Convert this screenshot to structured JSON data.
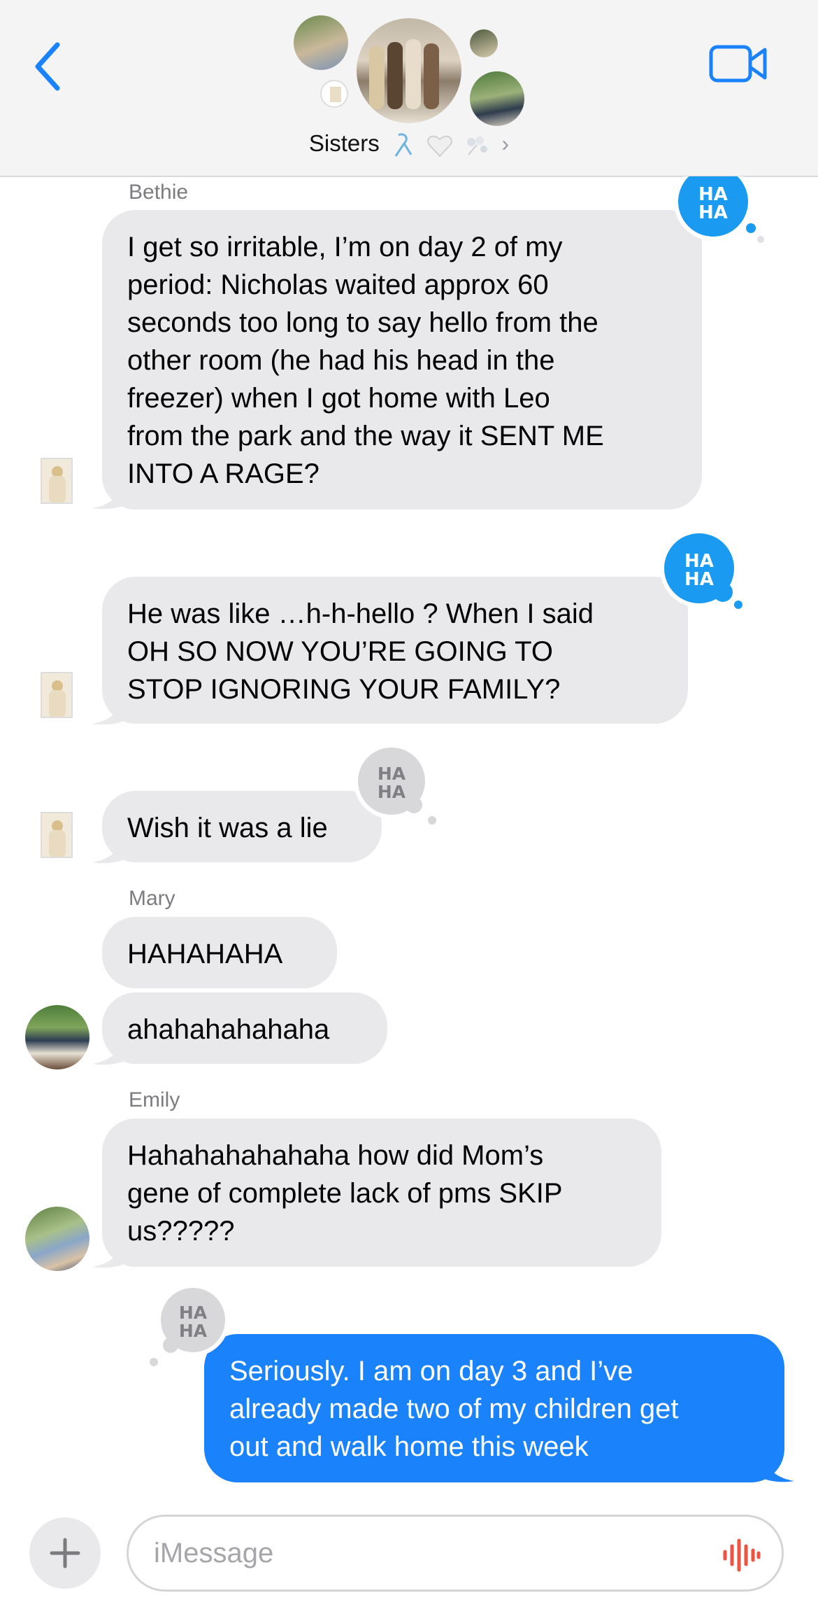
{
  "header": {
    "back_icon": "chevron-left-icon",
    "video_icon": "video-camera-icon",
    "group_name": "Sisters",
    "title_emoji": [
      "ribbon-icon",
      "white-heart-icon",
      "blossom-icon"
    ],
    "chevron": "›"
  },
  "messages": [
    {
      "sender": "Bethie",
      "text_lines": [
        "I get so irritable, I’m on day 2 of my",
        "period: Nicholas waited approx 60",
        "seconds too long to say hello from the",
        "other room (he had his head in the",
        "freezer) when I got home with Leo",
        "from the park and the way it SENT ME",
        "INTO A RAGE?"
      ],
      "tapback": "HA HA"
    },
    {
      "text_lines": [
        "He was like …h-h-hello ? When I said",
        "OH SO NOW YOU’RE GOING TO",
        "STOP IGNORING YOUR FAMILY?"
      ],
      "tapback": "HA HA"
    },
    {
      "text_lines": [
        "Wish it was a lie"
      ],
      "tapback": "HA HA"
    },
    {
      "sender": "Mary",
      "text_lines": [
        "HAHAHAHA"
      ]
    },
    {
      "text_lines": [
        "ahahahahahaha"
      ]
    },
    {
      "sender": "Emily",
      "text_lines": [
        "Hahahahahahaha how did Mom’s",
        "gene of complete lack of pms SKIP",
        "us?????"
      ]
    },
    {
      "outgoing": true,
      "text_lines": [
        "Seriously. I am on day 3 and I’ve",
        "already made two of my children get",
        "out and walk home this week"
      ],
      "tapback": "HA HA"
    }
  ],
  "composer": {
    "plus_icon": "plus-icon",
    "placeholder": "iMessage",
    "mic_icon": "audio-waveform-icon"
  },
  "colors": {
    "accent": "#1a82fb",
    "incoming_bubble": "#e9e9eb",
    "tapback_blue": "#1a9af0",
    "tapback_gray": "#d8d8da",
    "waveform": "#f0533f"
  }
}
